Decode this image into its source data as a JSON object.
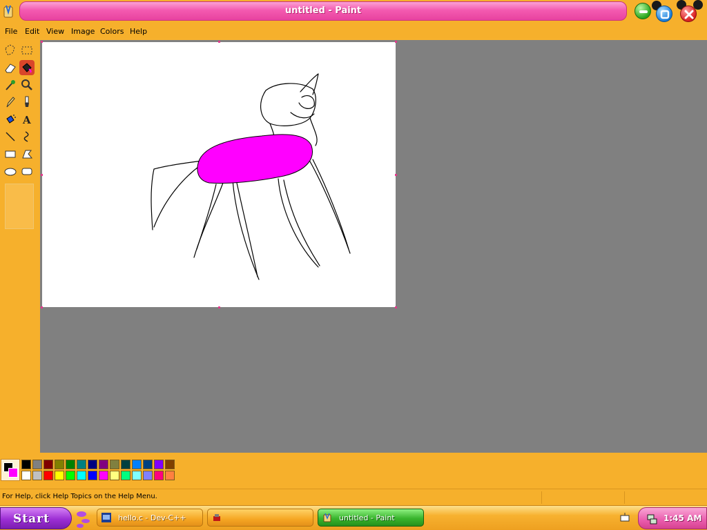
{
  "window": {
    "title": "untitled - Paint"
  },
  "menu": {
    "items": [
      {
        "label": "File"
      },
      {
        "label": "Edit"
      },
      {
        "label": "View"
      },
      {
        "label": "Image"
      },
      {
        "label": "Colors"
      },
      {
        "label": "Help"
      }
    ]
  },
  "tools": [
    {
      "icon": "free-form-select-icon"
    },
    {
      "icon": "rect-select-icon"
    },
    {
      "icon": "eraser-icon"
    },
    {
      "icon": "fill-bucket-icon",
      "selected": true
    },
    {
      "icon": "color-picker-icon"
    },
    {
      "icon": "magnifier-icon"
    },
    {
      "icon": "pencil-icon"
    },
    {
      "icon": "brush-icon"
    },
    {
      "icon": "airbrush-icon"
    },
    {
      "icon": "text-icon",
      "glyph": "A"
    },
    {
      "icon": "line-icon"
    },
    {
      "icon": "curve-icon"
    },
    {
      "icon": "rectangle-icon"
    },
    {
      "icon": "polygon-icon"
    },
    {
      "icon": "ellipse-icon"
    },
    {
      "icon": "rounded-rect-icon"
    }
  ],
  "colors": {
    "foreground": "#000000",
    "background": "#ff00ff",
    "fill_color": "#ff00ff",
    "palette_top": [
      "#000000",
      "#808080",
      "#800000",
      "#808000",
      "#008000",
      "#008080",
      "#000080",
      "#800080",
      "#808040",
      "#004040",
      "#0080ff",
      "#004080",
      "#8000ff",
      "#804000"
    ],
    "palette_bottom": [
      "#ffffff",
      "#c0c0c0",
      "#ff0000",
      "#ffff00",
      "#00ff00",
      "#00ffff",
      "#0000ff",
      "#ff00ff",
      "#ffff80",
      "#00ff80",
      "#80ffff",
      "#8080ff",
      "#ff0080",
      "#ff8040"
    ]
  },
  "status": {
    "help_text": "For Help, click Help Topics on the Help Menu."
  },
  "taskbar": {
    "start_label": "Start",
    "tasks": [
      {
        "label": "hello.c - Dev-C++",
        "active": false
      },
      {
        "label": "",
        "active": false
      },
      {
        "label": "untitled - Paint",
        "active": true
      }
    ],
    "clock": "1:45 AM"
  }
}
